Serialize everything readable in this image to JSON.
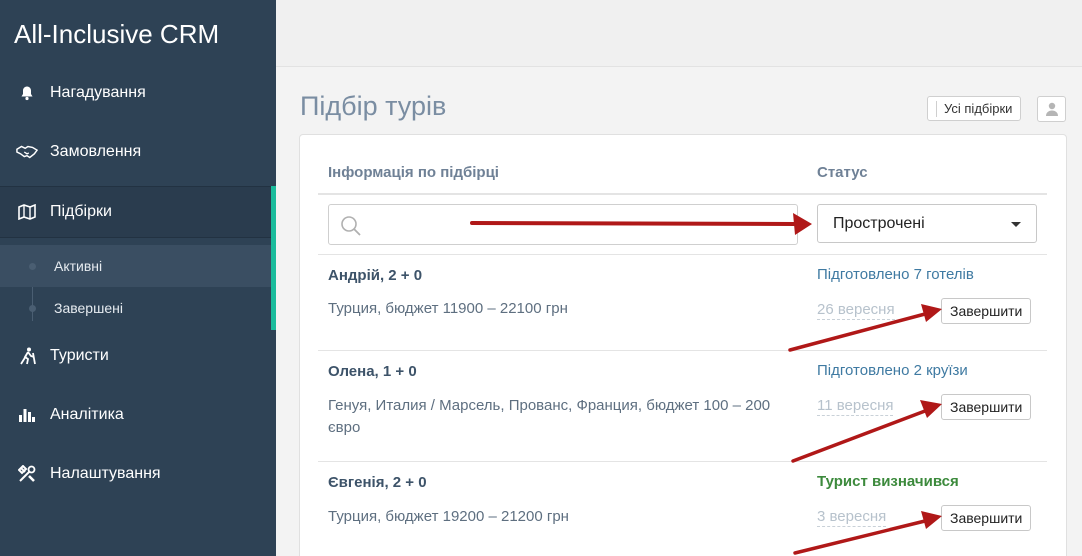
{
  "app": {
    "brand": "All-Inclusive CRM"
  },
  "sidebar": {
    "items": [
      {
        "label": "Нагадування",
        "icon": "bell-icon"
      },
      {
        "label": "Замовлення",
        "icon": "handshake-icon"
      },
      {
        "label": "Підбірки",
        "icon": "map-icon"
      },
      {
        "label": "Туристи",
        "icon": "hiker-icon"
      },
      {
        "label": "Аналітика",
        "icon": "bar-chart-icon"
      },
      {
        "label": "Налаштування",
        "icon": "tools-icon"
      }
    ],
    "sub_items": [
      {
        "label": "Активні"
      },
      {
        "label": "Завершені"
      }
    ],
    "accent_color": "#1abc9c"
  },
  "page": {
    "title": "Підбір турів",
    "all_button": "Усі підбірки"
  },
  "table": {
    "col_info": "Інформація по підбірці",
    "col_status": "Статус",
    "search_placeholder": "",
    "status_filter": "Прострочені",
    "rows": [
      {
        "name": "Андрій, 2 + 0",
        "desc": "Турция, бюджет 11900 – 22100 грн",
        "status": "Підготовлено 7 готелів",
        "date": "26 вересня",
        "action": "Завершити"
      },
      {
        "name": "Олена, 1 + 0",
        "desc": "Генуя, Италия / Марсель, Прованс, Франция, бюджет 100 – 200 євро",
        "status": "Підготовлено 2 круїзи",
        "date": "11 вересня",
        "action": "Завершити"
      },
      {
        "name": "Євгенія, 2 + 0",
        "desc": "Турция, бюджет 19200 – 21200 грн",
        "status": "Турист визначився",
        "date": "3 вересня",
        "action": "Завершити"
      }
    ]
  },
  "colors": {
    "sidebar": "#2e4255",
    "arrow": "#b01818",
    "status_blue": "#3f7aa2",
    "status_green": "#3c8a3c"
  }
}
